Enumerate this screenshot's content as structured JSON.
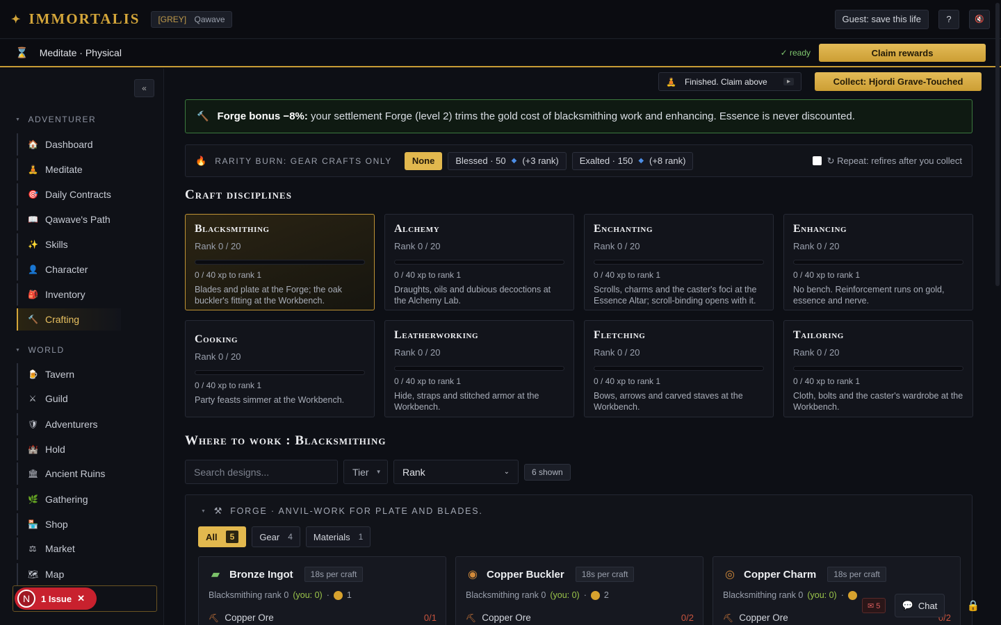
{
  "header": {
    "logo_star": "✦",
    "logo": "IMMORTALIS",
    "tag": "[GREY]",
    "player": "Qawave",
    "guest_save": "Guest: save this life",
    "help": "?",
    "mute_icon": "speaker-muted-icon"
  },
  "activity": {
    "label": "Meditate · Physical",
    "ready": "✓ ready",
    "claim": "Claim rewards",
    "finished": "Finished. Claim above",
    "finished_chevron": "▸",
    "collect": "Collect: Hjordi Grave-Touched"
  },
  "sidebar": {
    "collapse": "«",
    "adventurer_label": "ADVENTURER",
    "adventurer_items": [
      {
        "label": "Dashboard",
        "icon": "🏠"
      },
      {
        "label": "Meditate",
        "icon": "🧘"
      },
      {
        "label": "Daily Contracts",
        "icon": "🎯"
      },
      {
        "label": "Qawave's Path",
        "icon": "📖"
      },
      {
        "label": "Skills",
        "icon": "✨"
      },
      {
        "label": "Character",
        "icon": "👤"
      },
      {
        "label": "Inventory",
        "icon": "🎒"
      },
      {
        "label": "Crafting",
        "icon": "🔨"
      }
    ],
    "world_label": "WORLD",
    "world_items": [
      {
        "label": "Tavern",
        "icon": "🍺"
      },
      {
        "label": "Guild",
        "icon": "⚔"
      },
      {
        "label": "Adventurers",
        "icon": "🛡"
      },
      {
        "label": "Hold",
        "icon": "🏰"
      },
      {
        "label": "Ancient Ruins",
        "icon": "🏛"
      },
      {
        "label": "Gathering",
        "icon": "🌿"
      },
      {
        "label": "Shop",
        "icon": "🏪"
      },
      {
        "label": "Market",
        "icon": "⚖"
      },
      {
        "label": "Map",
        "icon": "🗺"
      }
    ],
    "issue_letter": "N",
    "issue_text": "1 Issue",
    "issue_close": "✕"
  },
  "forge_bonus": {
    "lead": "Forge bonus −8%:",
    "text": "your settlement Forge (level 2) trims the gold cost of blacksmithing work and enhancing. Essence is never discounted."
  },
  "rarity": {
    "label": "RARITY BURN: GEAR CRAFTS ONLY",
    "none": "None",
    "blessed": "Blessed · 50",
    "blessed_rank": "(+3 rank)",
    "exalted": "Exalted · 150",
    "exalted_rank": "(+8 rank)",
    "repeat": "↻ Repeat: refires after you collect"
  },
  "disciplines_title": "Craft disciplines",
  "disciplines": [
    {
      "name": "Blacksmithing",
      "rank": "Rank 0 / 20",
      "xp": "0 / 40 xp to rank 1",
      "desc": "Blades and plate at the Forge; the oak buckler's fitting at the Workbench."
    },
    {
      "name": "Alchemy",
      "rank": "Rank 0 / 20",
      "xp": "0 / 40 xp to rank 1",
      "desc": "Draughts, oils and dubious decoctions at the Alchemy Lab."
    },
    {
      "name": "Enchanting",
      "rank": "Rank 0 / 20",
      "xp": "0 / 40 xp to rank 1",
      "desc": "Scrolls, charms and the caster's foci at the Essence Altar; scroll-binding opens with it."
    },
    {
      "name": "Enhancing",
      "rank": "Rank 0 / 20",
      "xp": "0 / 40 xp to rank 1",
      "desc": "No bench. Reinforcement runs on gold, essence and nerve."
    },
    {
      "name": "Cooking",
      "rank": "Rank 0 / 20",
      "xp": "0 / 40 xp to rank 1",
      "desc": "Party feasts simmer at the Workbench."
    },
    {
      "name": "Leatherworking",
      "rank": "Rank 0 / 20",
      "xp": "0 / 40 xp to rank 1",
      "desc": "Hide, straps and stitched armor at the Workbench."
    },
    {
      "name": "Fletching",
      "rank": "Rank 0 / 20",
      "xp": "0 / 40 xp to rank 1",
      "desc": "Bows, arrows and carved staves at the Workbench."
    },
    {
      "name": "Tailoring",
      "rank": "Rank 0 / 20",
      "xp": "0 / 40 xp to rank 1",
      "desc": "Cloth, bolts and the caster's wardrobe at the Workbench."
    }
  ],
  "work_title": "Where to work : Blacksmithing",
  "filters": {
    "search_placeholder": "Search designs...",
    "tier": "Tier",
    "rank": "Rank",
    "shown": "6 shown"
  },
  "forge": {
    "header": "FORGE · ANVIL-WORK FOR PLATE AND BLADES.",
    "tabs": [
      {
        "label": "All",
        "count": "5"
      },
      {
        "label": "Gear",
        "count": "4"
      },
      {
        "label": "Materials",
        "count": "1"
      }
    ],
    "items": [
      {
        "name": "Bronze Ingot",
        "time": "18s per craft",
        "req": "Blacksmithing rank 0",
        "you": "(you: 0)",
        "cost": "1",
        "mat": "Copper Ore",
        "need": "0/1"
      },
      {
        "name": "Copper Buckler",
        "time": "18s per craft",
        "req": "Blacksmithing rank 0",
        "you": "(you: 0)",
        "cost": "2",
        "mat": "Copper Ore",
        "need": "0/2"
      },
      {
        "name": "Copper Charm",
        "time": "18s per craft",
        "req": "Blacksmithing rank 0",
        "you": "(you: 0)",
        "cost": "",
        "mat": "Copper Ore",
        "need": "0/2"
      }
    ]
  },
  "footer": {
    "mail": "✉ 5",
    "chat": "Chat",
    "lock": "🔒"
  }
}
